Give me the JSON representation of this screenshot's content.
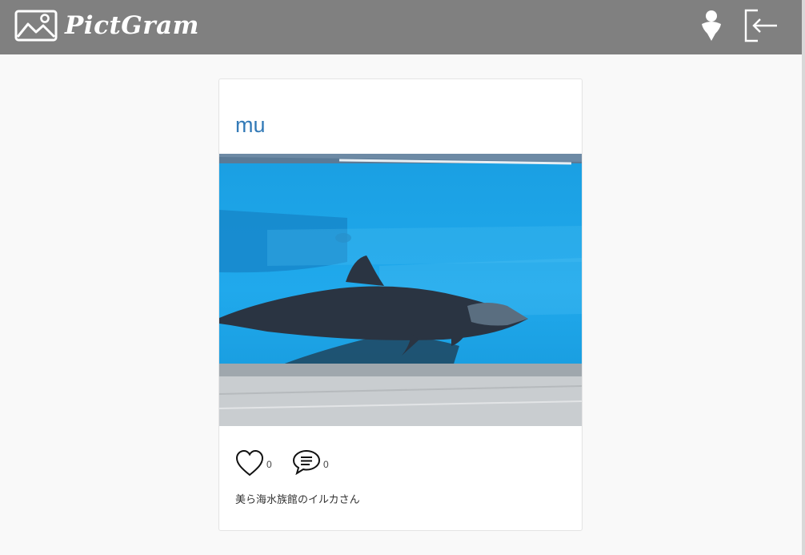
{
  "header": {
    "app_name": "PictGram",
    "logo_icon": "picture-icon",
    "user_icon": "user-icon",
    "logout_icon": "logout-icon"
  },
  "post": {
    "username": "mu",
    "image_alt": "dolphin-photo",
    "like_icon": "heart-outline-icon",
    "like_count": "0",
    "comment_icon": "comment-bubble-icon",
    "comment_count": "0",
    "caption": "美ら海水族館のイルカさん"
  },
  "colors": {
    "header_bg": "#808080",
    "page_bg": "#f9f9f9",
    "username_link": "#337ab7",
    "water": "#1aa3e6"
  }
}
